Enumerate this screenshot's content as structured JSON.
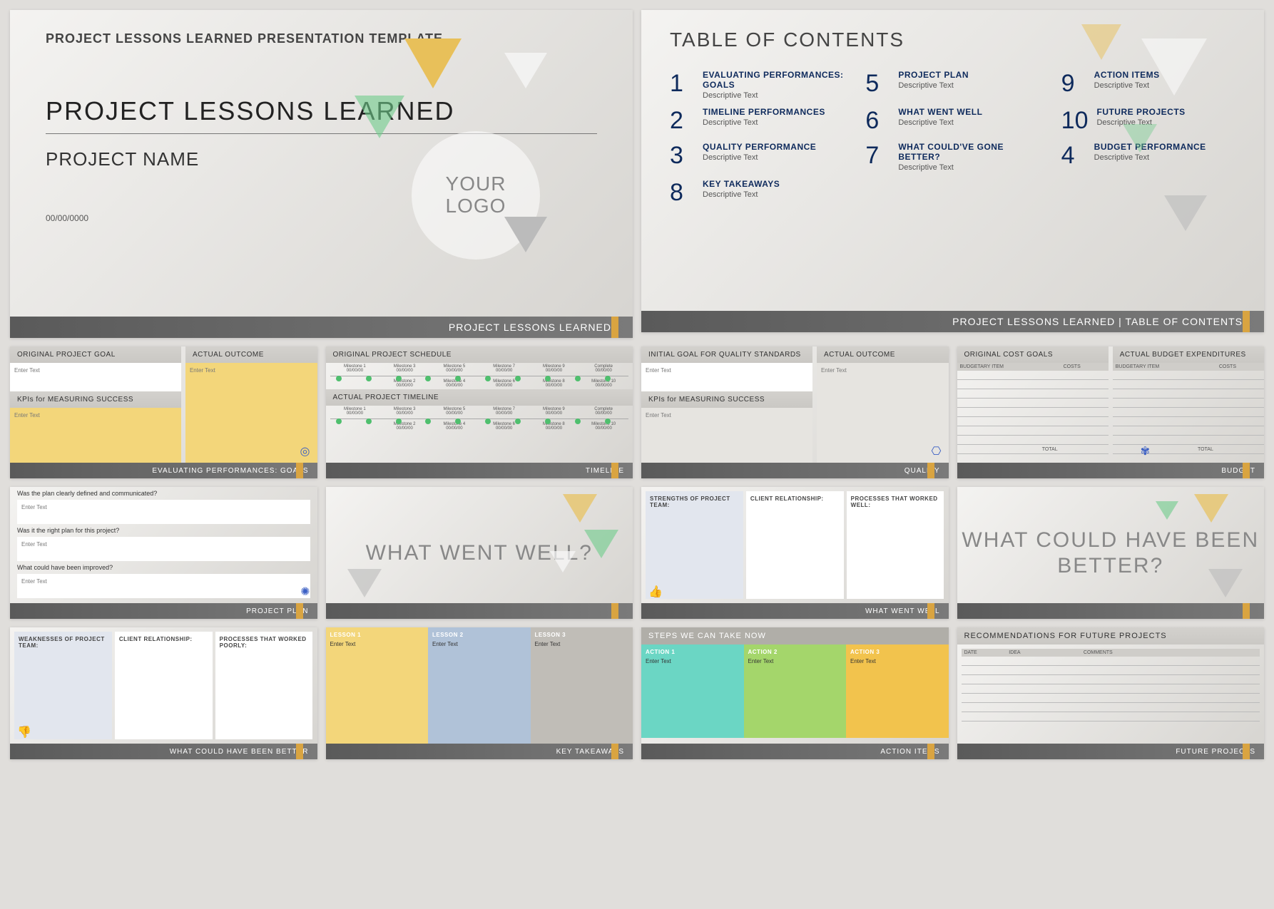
{
  "slide1": {
    "header": "PROJECT LESSONS LEARNED PRESENTATION TEMPLATE",
    "title": "PROJECT LESSONS LEARNED",
    "subtitle": "PROJECT NAME",
    "date": "00/00/0000",
    "logo1": "YOUR",
    "logo2": "LOGO",
    "footer": "PROJECT LESSONS LEARNED"
  },
  "slide2": {
    "title": "TABLE OF CONTENTS",
    "footer": "PROJECT LESSONS LEARNED   |   TABLE OF CONTENTS",
    "items": [
      {
        "n": "1",
        "label": "EVALUATING PERFORMANCES: GOALS",
        "desc": "Descriptive Text"
      },
      {
        "n": "5",
        "label": "PROJECT PLAN",
        "desc": "Descriptive Text"
      },
      {
        "n": "9",
        "label": "ACTION ITEMS",
        "desc": "Descriptive Text"
      },
      {
        "n": "2",
        "label": "TIMELINE PERFORMANCES",
        "desc": "Descriptive Text"
      },
      {
        "n": "6",
        "label": "WHAT WENT WELL",
        "desc": "Descriptive Text"
      },
      {
        "n": "10",
        "label": "FUTURE PROJECTS",
        "desc": "Descriptive Text"
      },
      {
        "n": "3",
        "label": "QUALITY PERFORMANCE",
        "desc": "Descriptive Text"
      },
      {
        "n": "7",
        "label": "WHAT COULD'VE GONE BETTER?",
        "desc": "Descriptive Text"
      },
      {
        "n": "4",
        "label": "BUDGET PERFORMANCE",
        "desc": "Descriptive Text"
      },
      {
        "n": "8",
        "label": "KEY TAKEAWAYS",
        "desc": "Descriptive Text"
      }
    ]
  },
  "slide3": {
    "h1": "ORIGINAL PROJECT GOAL",
    "h2": "ACTUAL OUTCOME",
    "h3": "KPIs for MEASURING SUCCESS",
    "enter": "Enter Text",
    "footer": "EVALUATING PERFORMANCES: GOALS"
  },
  "slide4": {
    "h1": "ORIGINAL PROJECT SCHEDULE",
    "h2": "ACTUAL PROJECT TIMELINE",
    "footer": "TIMELINE",
    "ms_top_a": [
      "Milestone 1",
      "Milestone 3",
      "Milestone 5",
      "Milestone 7",
      "Milestone 9",
      "Complete"
    ],
    "ms_top_b": [
      "Milestone 2",
      "Milestone 4",
      "Milestone 6",
      "Milestone 8",
      "Milestone 10"
    ],
    "date": "00/00/00"
  },
  "slide5": {
    "h1": "INITIAL GOAL FOR QUALITY STANDARDS",
    "h2": "ACTUAL OUTCOME",
    "h3": "KPIs for MEASURING SUCCESS",
    "enter": "Enter Text",
    "footer": "QUALITY"
  },
  "slide6": {
    "h1": "ORIGINAL COST GOALS",
    "h2": "ACTUAL BUDGET EXPENDITURES",
    "th1": "BUDGETARY ITEM",
    "th2": "COSTS",
    "total": "TOTAL",
    "footer": "BUDGET"
  },
  "slide7": {
    "q1": "Was the plan clearly defined and communicated?",
    "q2": "Was it the right plan for this project?",
    "q3": "What could have been improved?",
    "enter": "Enter Text",
    "footer": "PROJECT PLAN"
  },
  "slide8": {
    "title": "WHAT WENT WELL?"
  },
  "slide9": {
    "c1": "STRENGTHS OF PROJECT TEAM:",
    "c2": "CLIENT RELATIONSHIP:",
    "c3": "PROCESSES THAT WORKED WELL:",
    "footer": "WHAT WENT WELL"
  },
  "slide10": {
    "title": "WHAT COULD HAVE BEEN BETTER?"
  },
  "slide11": {
    "c1": "WEAKNESSES OF PROJECT TEAM:",
    "c2": "CLIENT RELATIONSHIP:",
    "c3": "PROCESSES THAT WORKED POORLY:",
    "footer": "WHAT COULD HAVE BEEN BETTER"
  },
  "slide12": {
    "l1": "LESSON 1",
    "l2": "LESSON 2",
    "l3": "LESSON 3",
    "enter": "Enter Text",
    "footer": "KEY TAKEAWAYS"
  },
  "slide13": {
    "title": "STEPS WE CAN TAKE NOW",
    "a1": "ACTION 1",
    "a2": "ACTION 2",
    "a3": "ACTION 3",
    "enter": "Enter Text",
    "footer": "ACTION ITEMS"
  },
  "slide14": {
    "title": "RECOMMENDATIONS FOR FUTURE PROJECTS",
    "th1": "DATE",
    "th2": "IDEA",
    "th3": "COMMENTS",
    "footer": "FUTURE PROJECTS"
  }
}
